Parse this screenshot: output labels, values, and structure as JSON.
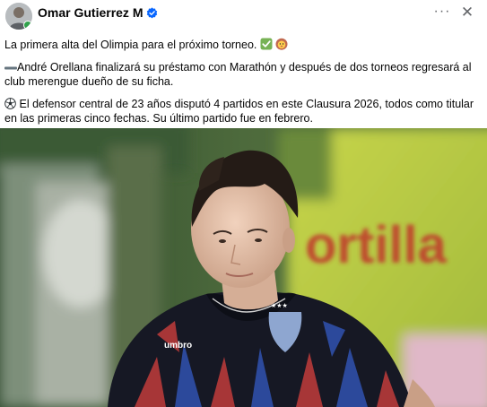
{
  "post": {
    "author": "Omar Gutierrez M",
    "paragraphs": [
      "La primera alta del Olimpia para el próximo torneo.",
      "André Orellana finalizará su préstamo con Marathón y después de dos torneos regresará al club merengue dueño de su ficha.",
      "El defensor central de 23 años disputó 4 partidos en este Clausura 2026, todos como titular en las primeras cinco fechas. Su último partido fue en febrero."
    ],
    "photo": {
      "sponsor_text": "ortilla",
      "shirt_brand": "umbro"
    }
  },
  "icons": {
    "verified": "verified-badge-icon",
    "more": "more-options-icon",
    "close": "close-icon",
    "check_emoji": "check-mark-emoji",
    "lion_emoji": "lion-emoji",
    "dash_emoji": "heavy-minus-emoji",
    "ball_emoji": "soccer-ball-emoji"
  },
  "colors": {
    "verified_blue": "#0866ff",
    "text": "#050505",
    "secondary": "#65676b",
    "check_green": "#77b255"
  }
}
